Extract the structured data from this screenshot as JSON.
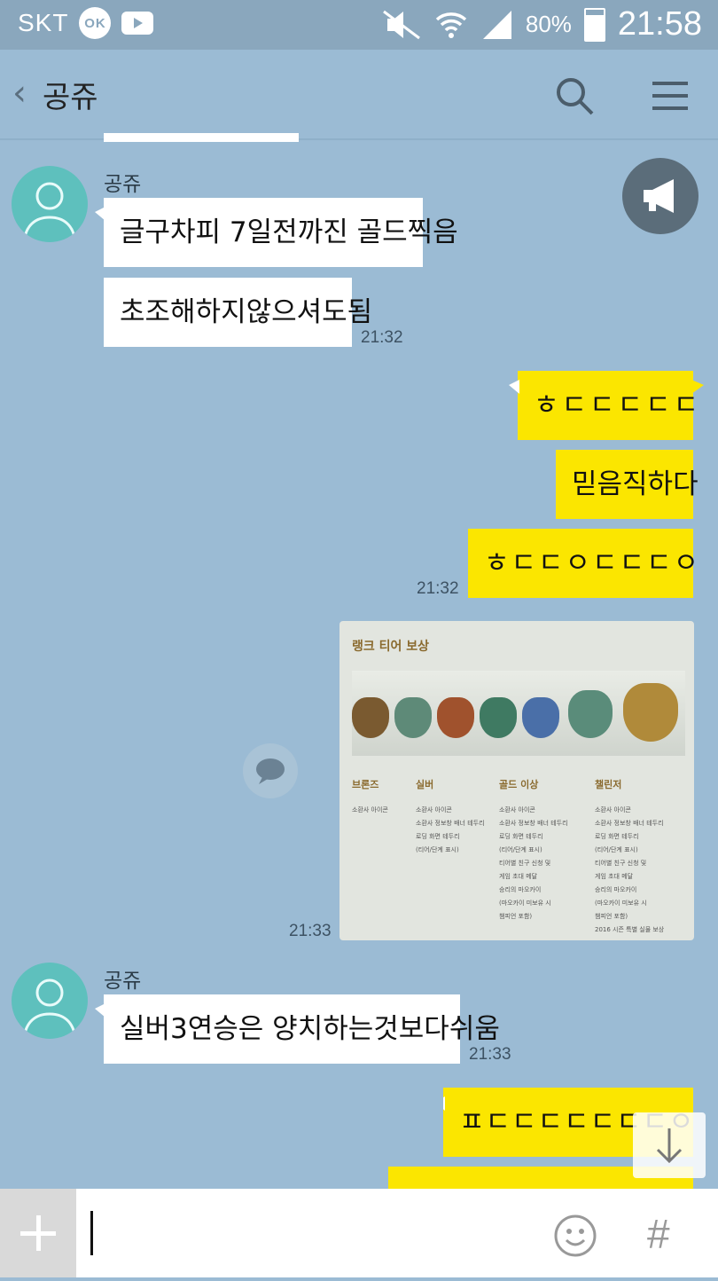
{
  "status_bar": {
    "carrier": "SKT",
    "ok_badge": "OK",
    "battery": "80%",
    "battery_fraction": 0.8,
    "time": "21:58"
  },
  "header": {
    "title": "공쥬"
  },
  "messages": {
    "m1_sender": "공쥬",
    "m1_text1": "글구차피 7일전까진 골드찍음",
    "m1_text2": "초조해하지않으셔도됨",
    "m1_time": "21:32",
    "m2_text1": "ㅎㄷㄷㄷㄷㄷ",
    "m2_text2": "믿음직하다",
    "m2_text3": "ㅎㄷㄷㅇㄷㄷㄷㅇ",
    "m2_time": "21:32",
    "img_time": "21:33",
    "m3_sender": "공쥬",
    "m3_text": "실버3연승은 양치하는것보다쉬움",
    "m3_time": "21:33",
    "m4_text": "ㅍㄷㄷㄷㄷㄷㄷㄷㅇㅇ"
  },
  "image_card": {
    "title": "랭크 티어 보상",
    "columns": [
      {
        "header": "브론즈",
        "items": [
          "소환사 아이콘"
        ]
      },
      {
        "header": "실버",
        "items": [
          "소환사 아이콘",
          "소환사 정보창 배너 테두리",
          "로딩 화면 테두리",
          "(티어/단계 표시)"
        ]
      },
      {
        "header": "골드 이상",
        "items": [
          "소환사 아이콘",
          "소환사 정보창 배너 테두리",
          "로딩 화면 테두리",
          "(티어/단계 표시)",
          "티어별 친구 신청 및",
          "게임 초대 메달",
          "승리의 마오카이",
          "(마오카이 미보유 시",
          "챔피언 포함)"
        ]
      },
      {
        "header": "챌린저",
        "items": [
          "소환사 아이콘",
          "소환사 정보창 배너 테두리",
          "로딩 화면 테두리",
          "(티어/단계 표시)",
          "티어별 친구 신청 및",
          "게임 초대 메달",
          "승리의 마오카이",
          "(마오카이 미보유 시",
          "챔피언 포함)",
          "2016 시즌 특별 실물 보상"
        ]
      }
    ]
  },
  "input": {
    "placeholder": ""
  },
  "bottom": {
    "hash": "#"
  },
  "colors": {
    "background": "#9bbbd4",
    "my_bubble": "#fbe600",
    "other_bubble": "#ffffff"
  }
}
